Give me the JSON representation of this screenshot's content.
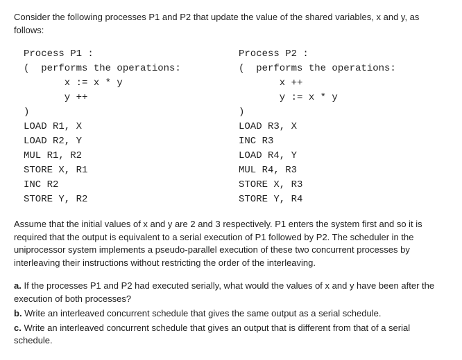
{
  "intro": "Consider the following processes P1 and P2 that update the value of the shared variables, x and y, as follows:",
  "p1": {
    "header": "Process P1 :",
    "open": "(  performs the operations:",
    "op1": "       x := x * y",
    "op2": "       y ++",
    "close": ")",
    "i1": "LOAD R1, X",
    "i2": "LOAD R2, Y",
    "i3": "MUL R1, R2",
    "i4": "STORE X, R1",
    "i5": "INC R2",
    "i6": "STORE Y, R2"
  },
  "p2": {
    "header": "Process P2 :",
    "open": "(  performs the operations:",
    "op1": "       x ++",
    "op2": "       y := x * y",
    "close": ")",
    "i1": "LOAD R3, X",
    "i2": "INC R3",
    "i3": "LOAD R4, Y",
    "i4": "MUL R4, R3",
    "i5": "STORE X, R3",
    "i6": "STORE Y, R4"
  },
  "assumption": "Assume that the initial values of x and y are 2 and 3 respectively. P1 enters the system first and so it is required that the output is equivalent to a serial execution of P1 followed by P2. The scheduler in the uniprocessor system implements a pseudo-parallel execution of these two concurrent processes by interleaving their instructions without restricting the order of the interleaving.",
  "qa_label": "a.",
  "qa_text": " If the processes P1 and P2 had executed serially, what would the values of x and y have been after the execution of both processes?",
  "qb_label": "b.",
  "qb_text": " Write an interleaved concurrent schedule that gives the same output as a serial schedule.",
  "qc_label": "c.",
  "qc_text": " Write an interleaved concurrent schedule that gives an output that is different from that of a serial schedule."
}
